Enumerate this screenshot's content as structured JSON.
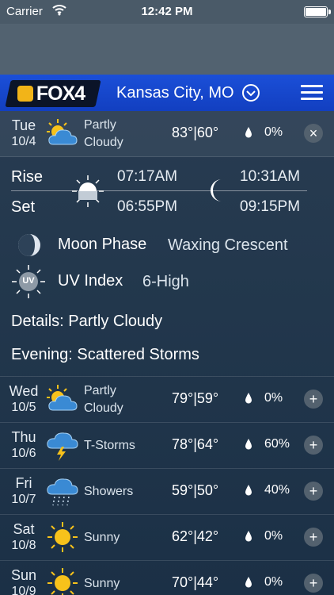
{
  "status_bar": {
    "carrier": "Carrier",
    "time": "12:42 PM"
  },
  "header": {
    "logo_text": "FOX4",
    "city": "Kansas City, MO"
  },
  "today": {
    "day": "Tue",
    "date": "10/4",
    "condition_line1": "Partly",
    "condition_line2": "Cloudy",
    "temps": "83°|60°",
    "precip": "0%",
    "icon": "partly-cloudy-icon"
  },
  "sun_moon": {
    "rise_label": "Rise",
    "set_label": "Set",
    "sunrise": "07:17AM",
    "sunset": "06:55PM",
    "moonrise": "10:31AM",
    "moonset": "09:15PM"
  },
  "moon_phase": {
    "label": "Moon Phase",
    "value": "Waxing Crescent"
  },
  "uv": {
    "label": "UV Index",
    "value": "6-High",
    "badge": "UV"
  },
  "details": "Details: Partly Cloudy",
  "evening": "Evening: Scattered Storms",
  "forecast": [
    {
      "day": "Wed",
      "date": "10/5",
      "condition_line1": "Partly",
      "condition_line2": "Cloudy",
      "temps": "79°|59°",
      "precip": "0%",
      "icon": "partly-cloudy-icon"
    },
    {
      "day": "Thu",
      "date": "10/6",
      "condition_line1": "T-Storms",
      "condition_line2": "",
      "temps": "78°|64°",
      "precip": "60%",
      "icon": "thunderstorm-icon"
    },
    {
      "day": "Fri",
      "date": "10/7",
      "condition_line1": "Showers",
      "condition_line2": "",
      "temps": "59°|50°",
      "precip": "40%",
      "icon": "showers-icon"
    },
    {
      "day": "Sat",
      "date": "10/8",
      "condition_line1": "Sunny",
      "condition_line2": "",
      "temps": "62°|42°",
      "precip": "0%",
      "icon": "sunny-icon"
    },
    {
      "day": "Sun",
      "date": "10/9",
      "condition_line1": "Sunny",
      "condition_line2": "",
      "temps": "70°|44°",
      "precip": "0%",
      "icon": "sunny-icon"
    }
  ],
  "colors": {
    "header_blue": "#1b4fd8",
    "sun_yellow": "#f7c21b",
    "logo_yellow": "#f2b418"
  }
}
